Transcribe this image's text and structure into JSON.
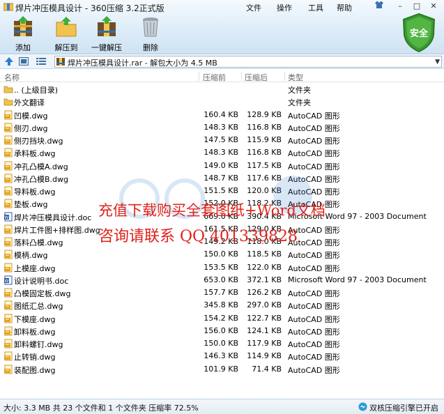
{
  "window": {
    "title": "焊片冲压模具设计 - 360压缩 3.2正式版",
    "menu": {
      "file": "文件",
      "operations": "操作",
      "tools": "工具",
      "help": "帮助"
    },
    "controls": {
      "minimize": "–",
      "maximize": "□",
      "close": "✕"
    }
  },
  "toolbar": {
    "add": "添加",
    "extract_to": "解压到",
    "one_click_extract": "一键解压",
    "delete": "删除",
    "security_badge": "安全"
  },
  "address": {
    "path": "焊片冲压模具设计.rar - 解包大小为 4.5 MB"
  },
  "columns": {
    "name": "名称",
    "size": "压缩前",
    "packed": "压缩后",
    "type": "类型"
  },
  "files": [
    {
      "icon": "folder-up-icon",
      "name": ".. (上级目录)",
      "size": "",
      "packed": "",
      "type": "文件夹"
    },
    {
      "icon": "folder-icon",
      "name": "外文翻译",
      "size": "",
      "packed": "",
      "type": "文件夹"
    },
    {
      "icon": "dwg-icon",
      "name": "凹模.dwg",
      "size": "160.4 KB",
      "packed": "128.9 KB",
      "type": "AutoCAD 图形"
    },
    {
      "icon": "dwg-icon",
      "name": "侧刃.dwg",
      "size": "148.3 KB",
      "packed": "116.8 KB",
      "type": "AutoCAD 图形"
    },
    {
      "icon": "dwg-icon",
      "name": "侧刃挡块.dwg",
      "size": "147.5 KB",
      "packed": "115.9 KB",
      "type": "AutoCAD 图形"
    },
    {
      "icon": "dwg-icon",
      "name": "承料板.dwg",
      "size": "148.3 KB",
      "packed": "116.8 KB",
      "type": "AutoCAD 图形"
    },
    {
      "icon": "dwg-icon",
      "name": "冲孔凸模A.dwg",
      "size": "149.0 KB",
      "packed": "117.5 KB",
      "type": "AutoCAD 图形"
    },
    {
      "icon": "dwg-icon",
      "name": "冲孔凸模B.dwg",
      "size": "148.7 KB",
      "packed": "117.6 KB",
      "type": "AutoCAD 图形"
    },
    {
      "icon": "dwg-icon",
      "name": "导料板.dwg",
      "size": "151.5 KB",
      "packed": "120.0 KB",
      "type": "AutoCAD 图形"
    },
    {
      "icon": "dwg-icon",
      "name": "垫板.dwg",
      "size": "152.0 KB",
      "packed": "118.2 KB",
      "type": "AutoCAD 图形"
    },
    {
      "icon": "doc-icon",
      "name": "焊片冲压模具设计.doc",
      "size": "669.0 KB",
      "packed": "390.4 KB",
      "type": "Microsoft Word 97 - 2003 Document"
    },
    {
      "icon": "dwg-icon",
      "name": "焊片工件图+排样图.dwg",
      "size": "161.5 KB",
      "packed": "129.0 KB",
      "type": "AutoCAD 图形"
    },
    {
      "icon": "dwg-icon",
      "name": "落料凸模.dwg",
      "size": "149.2 KB",
      "packed": "118.0 KB",
      "type": "AutoCAD 图形"
    },
    {
      "icon": "dwg-icon",
      "name": "模柄.dwg",
      "size": "150.0 KB",
      "packed": "118.5 KB",
      "type": "AutoCAD 图形"
    },
    {
      "icon": "dwg-icon",
      "name": "上模座.dwg",
      "size": "153.5 KB",
      "packed": "122.0 KB",
      "type": "AutoCAD 图形"
    },
    {
      "icon": "doc-icon",
      "name": "设计说明书.doc",
      "size": "653.0 KB",
      "packed": "372.1 KB",
      "type": "Microsoft Word 97 - 2003 Document"
    },
    {
      "icon": "dwg-icon",
      "name": "凸模固定板.dwg",
      "size": "157.7 KB",
      "packed": "126.2 KB",
      "type": "AutoCAD 图形"
    },
    {
      "icon": "dwg-icon",
      "name": "图纸汇总.dwg",
      "size": "345.8 KB",
      "packed": "297.0 KB",
      "type": "AutoCAD 图形"
    },
    {
      "icon": "dwg-icon",
      "name": "下模座.dwg",
      "size": "154.2 KB",
      "packed": "122.7 KB",
      "type": "AutoCAD 图形"
    },
    {
      "icon": "dwg-icon",
      "name": "卸料板.dwg",
      "size": "156.0 KB",
      "packed": "124.1 KB",
      "type": "AutoCAD 图形"
    },
    {
      "icon": "dwg-icon",
      "name": "卸料螺钉.dwg",
      "size": "150.0 KB",
      "packed": "117.9 KB",
      "type": "AutoCAD 图形"
    },
    {
      "icon": "dwg-icon",
      "name": "止转销.dwg",
      "size": "146.3 KB",
      "packed": "114.9 KB",
      "type": "AutoCAD 图形"
    },
    {
      "icon": "dwg-icon",
      "name": "装配图.dwg",
      "size": "101.9 KB",
      "packed": "71.4 KB",
      "type": "AutoCAD 图形"
    }
  ],
  "watermark": {
    "line1": "充值下载购买全套图纸+Word文档",
    "line2": "咨询请联系  QQ 401339828"
  },
  "status": {
    "summary": "大小: 3.3 MB 共 23 个文件和 1 个文件夹 压缩率 72.5%",
    "dual_core": "双核压缩引擎已开启"
  },
  "colors": {
    "watermark": "#e0221a",
    "folder": "#f2c24f",
    "accent": "#2b7cd3",
    "shield": "#3a9b2f"
  }
}
